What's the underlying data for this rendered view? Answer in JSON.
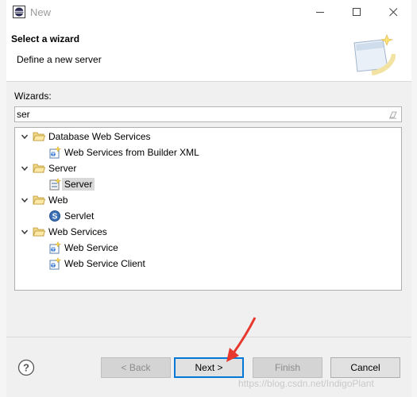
{
  "window": {
    "title": "New"
  },
  "banner": {
    "title": "Select a wizard",
    "description": "Define a new server"
  },
  "wizards_label": "Wizards:",
  "search": {
    "value": "ser"
  },
  "tree": [
    {
      "label": "Database Web Services",
      "type": "category",
      "expanded": true,
      "icon": "folder-icon"
    },
    {
      "label": "Web Services from Builder XML",
      "type": "item",
      "icon": "web-service-wizard-icon"
    },
    {
      "label": "Server",
      "type": "category",
      "expanded": true,
      "icon": "folder-icon"
    },
    {
      "label": "Server",
      "type": "item",
      "icon": "server-wizard-icon",
      "selected": true
    },
    {
      "label": "Web",
      "type": "category",
      "expanded": true,
      "icon": "folder-icon"
    },
    {
      "label": "Servlet",
      "type": "item",
      "icon": "servlet-icon"
    },
    {
      "label": "Web Services",
      "type": "category",
      "expanded": true,
      "icon": "folder-icon"
    },
    {
      "label": "Web Service",
      "type": "item",
      "icon": "web-service-wizard-icon"
    },
    {
      "label": "Web Service Client",
      "type": "item",
      "icon": "web-service-wizard-icon"
    }
  ],
  "buttons": {
    "back": "< Back",
    "next": "Next >",
    "finish": "Finish",
    "cancel": "Cancel"
  },
  "watermark": "https://blog.csdn.net/IndigoPlant",
  "colors": {
    "accent": "#0078d7",
    "annotation_arrow": "#e8372c",
    "folder": "#e8c46a",
    "servlet": "#3b6fb6"
  }
}
